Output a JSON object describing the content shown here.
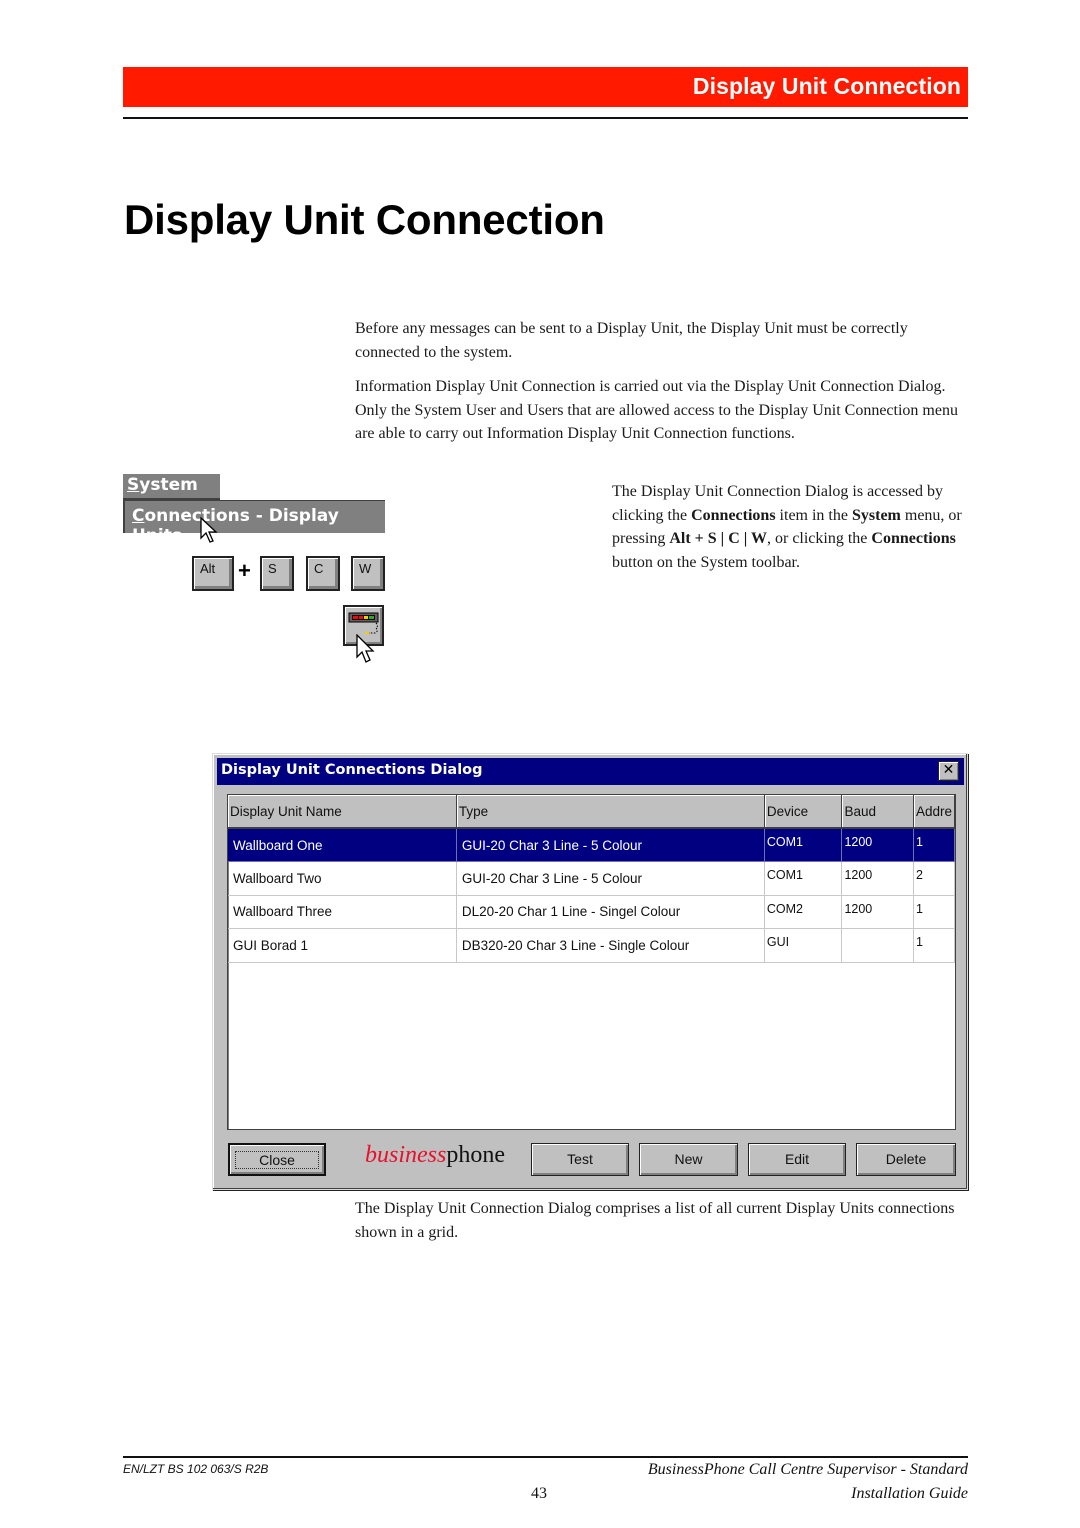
{
  "header": {
    "banner_title": "Display Unit Connection"
  },
  "page_title": "Display Unit Connection",
  "paragraphs": {
    "p1": "Before any messages can be sent to a Display Unit, the Display Unit must be correctly connected to the system.",
    "p2": "Information Display Unit Connection is carried out via the Display Unit Connection Dialog. Only the System User and Users that are allowed access to the Display Unit Connection menu are able to carry out Information Display Unit Connection functions.",
    "p3": {
      "t1": "The Display Unit Connection Dialog is accessed by clicking the ",
      "b1": "Connections",
      "t2": " item in the ",
      "b2": "System",
      "t3": " menu, or pressing ",
      "b3": "Alt + S | C | W",
      "t4": ", or clicking the ",
      "b4": "Connections",
      "t5": " button on the System toolbar."
    },
    "p4": "The Display Unit Connection Dialog comprises a list of all current Display Units connections shown in a grid."
  },
  "menu_illustration": {
    "menu_label_first": "S",
    "menu_label_rest": "ystem",
    "item_label_first": "C",
    "item_label_rest": "onnections - Display Units",
    "keys": [
      "Alt",
      "S",
      "C",
      "W"
    ],
    "plus": "+",
    "toolbar_button_icon": "display-unit-connections-icon"
  },
  "dialog": {
    "title": "Display Unit Connections Dialog",
    "close_glyph": "✕",
    "columns": [
      "Display Unit Name",
      "Type",
      "Device",
      "Baud",
      "Addre"
    ],
    "rows": [
      {
        "name": "Wallboard One",
        "type": "GUI-20 Char 3 Line - 5 Colour",
        "device": "COM1",
        "baud": "1200",
        "address": "1",
        "selected": true
      },
      {
        "name": "Wallboard Two",
        "type": "GUI-20 Char 3 Line - 5 Colour",
        "device": "COM1",
        "baud": "1200",
        "address": "2",
        "selected": false
      },
      {
        "name": "Wallboard Three",
        "type": "DL20-20 Char 1 Line - Singel Colour",
        "device": "COM2",
        "baud": "1200",
        "address": "1",
        "selected": false
      },
      {
        "name": "GUI Borad 1",
        "type": "DB320-20 Char 3 Line - Single Colour",
        "device": "GUI",
        "baud": "",
        "address": "1",
        "selected": false
      }
    ],
    "buttons": {
      "close": "Close",
      "test": "Test",
      "new": "New",
      "edit": "Edit",
      "delete": "Delete"
    },
    "brand": {
      "part1": "business",
      "part2": "phone"
    },
    "colors": {
      "titlebar": "#000080",
      "selection": "#000080",
      "brand_red": "#e8102a"
    }
  },
  "footer": {
    "doc_id": "EN/LZT BS 102 063/S R2B",
    "page_number": "43",
    "title_line1": "BusinessPhone Call Centre Supervisor - Standard",
    "title_line2": "Installation Guide"
  },
  "colors": {
    "banner": "#ff1a00"
  }
}
